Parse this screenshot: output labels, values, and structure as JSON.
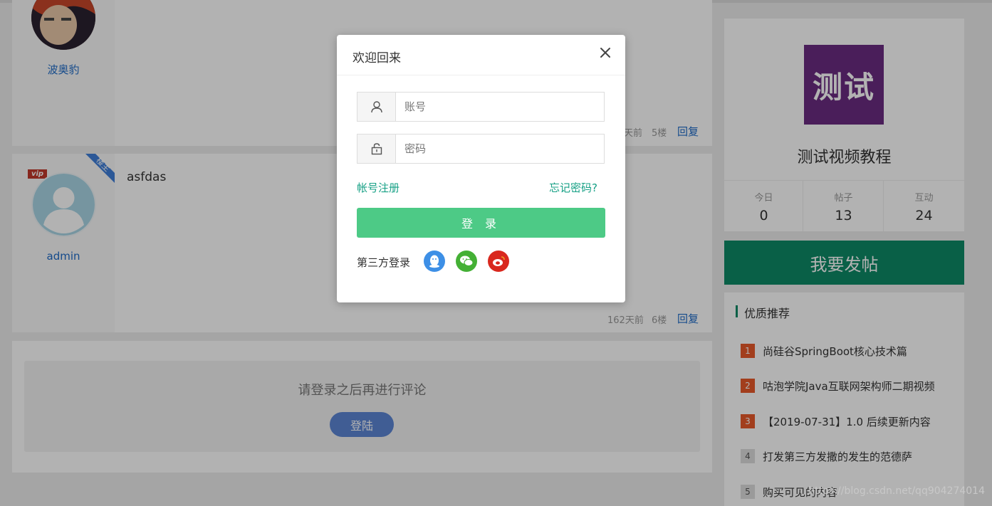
{
  "posts": [
    {
      "username": "波奥豹",
      "time": "天前",
      "floor": "5楼",
      "reply": "回复"
    },
    {
      "username": "admin",
      "badge": "楼主",
      "vip": "vip",
      "content": "asfdas",
      "time": "162天前",
      "floor": "6楼",
      "reply": "回复"
    }
  ],
  "comment_box": {
    "prompt": "请登录之后再进行评论",
    "login_button": "登陆"
  },
  "sidebar": {
    "logo_text": "测试",
    "title": "测试视频教程",
    "stats": [
      {
        "label": "今日",
        "value": "0"
      },
      {
        "label": "帖子",
        "value": "13"
      },
      {
        "label": "互动",
        "value": "24"
      }
    ],
    "post_button": "我要发帖",
    "recommend_title": "优质推荐",
    "recommend_items": [
      {
        "rank": "1",
        "title": "尚硅谷SpringBoot核心技术篇"
      },
      {
        "rank": "2",
        "title": "咕泡学院Java互联网架构师二期视频"
      },
      {
        "rank": "3",
        "title": "【2019-07-31】1.0 后续更新内容"
      },
      {
        "rank": "4",
        "title": "打发第三方发撒的发生的范德萨"
      },
      {
        "rank": "5",
        "title": "购买可见的内容"
      }
    ]
  },
  "watermark": "https://blog.csdn.net/qq904274014",
  "modal": {
    "title": "欢迎回来",
    "account_placeholder": "账号",
    "password_placeholder": "密码",
    "register_link": "帐号注册",
    "forgot_link": "忘记密码?",
    "login_button": "登 录",
    "third_party_label": "第三方登录"
  },
  "colors": {
    "accent_green": "#4dca86",
    "link_teal": "#16a085",
    "post_green": "#0e8a66",
    "qq_blue": "#3d8fe6",
    "wechat_green": "#44b035",
    "weibo_red": "#d9281e",
    "logo_purple": "#6a2c82"
  }
}
